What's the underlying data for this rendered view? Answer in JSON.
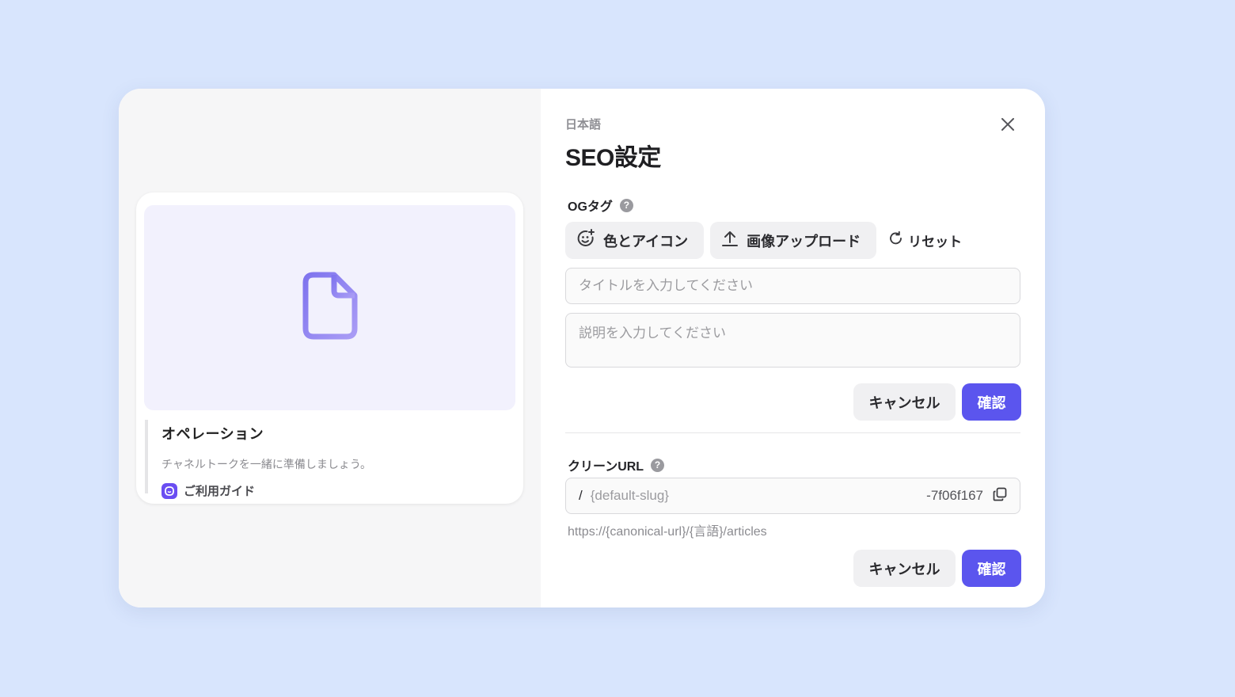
{
  "preview": {
    "title": "オペレーション",
    "description": "チャネルトークを一緒に準備しましょう。",
    "guide_label": "ご利用ガイド"
  },
  "header": {
    "language": "日本語",
    "title": "SEO設定"
  },
  "og_section": {
    "label": "OGタグ",
    "help": "?",
    "color_icon_label": "色とアイコン",
    "upload_label": "画像アップロード",
    "reset_label": "リセット",
    "title_placeholder": "タイトルを入力してください",
    "description_placeholder": "説明を入力してください",
    "cancel_label": "キャンセル",
    "confirm_label": "確認"
  },
  "clean_url_section": {
    "label": "クリーンURL",
    "help": "?",
    "slash": "/",
    "slug_placeholder": "{default-slug}",
    "suffix": "-7f06f167",
    "hint": "https://{canonical-url}/{言語}/articles",
    "cancel_label": "キャンセル",
    "confirm_label": "確認"
  },
  "colors": {
    "accent": "#5b55ee",
    "page_background": "#d8e5fd",
    "file_icon": "#8b7ef0"
  },
  "icons": {
    "file": "file-icon",
    "close": "close-icon",
    "emoji_add": "emoji-add-icon",
    "upload": "upload-icon",
    "reset": "reset-icon",
    "copy": "copy-icon",
    "help": "help-icon",
    "guide_logo": "channel-talk-logo-icon"
  }
}
